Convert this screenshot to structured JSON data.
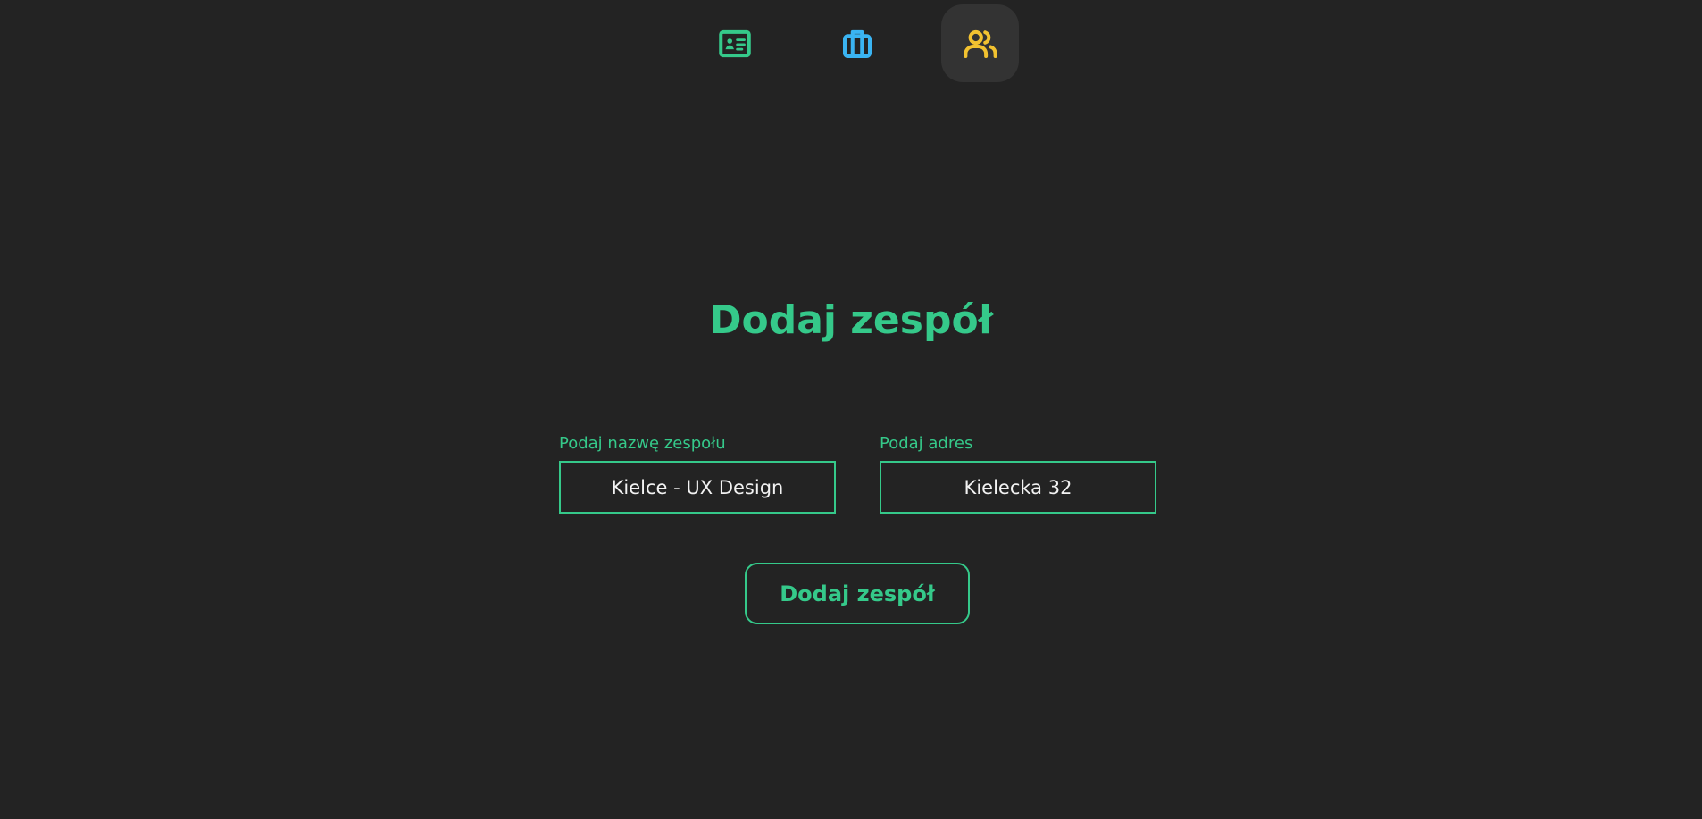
{
  "nav": {
    "items": [
      {
        "icon": "id-card-icon",
        "color": "#35c98a",
        "active": false
      },
      {
        "icon": "briefcase-icon",
        "color": "#3ab4f2",
        "active": false
      },
      {
        "icon": "users-icon",
        "color": "#f2c230",
        "active": true
      }
    ]
  },
  "page": {
    "title": "Dodaj zespół"
  },
  "form": {
    "name_label": "Podaj nazwę zespołu",
    "name_value": "Kielce - UX Design",
    "address_label": "Podaj adres",
    "address_value": "Kielecka 32",
    "submit_label": "Dodaj zespół"
  },
  "colors": {
    "background": "#232323",
    "accent": "#35c98a",
    "active_nav_bg": "#333333"
  }
}
